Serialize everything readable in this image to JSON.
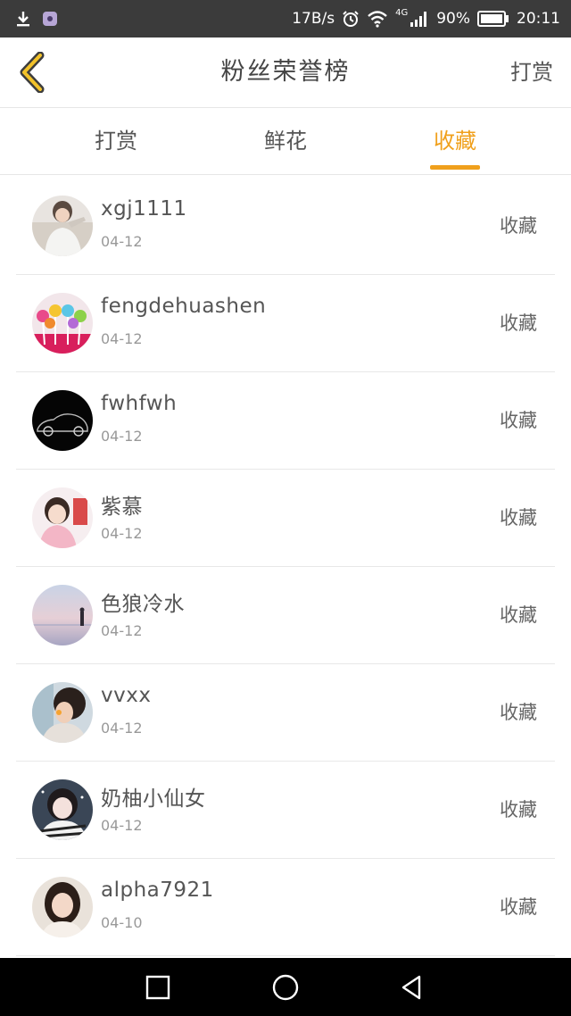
{
  "status_bar": {
    "speed": "17B/s",
    "network": "4G",
    "battery": "90%",
    "time": "20:11"
  },
  "header": {
    "title": "粉丝荣誉榜",
    "action": "打赏"
  },
  "tabs": [
    {
      "label": "打赏",
      "active": false
    },
    {
      "label": "鲜花",
      "active": false
    },
    {
      "label": "收藏",
      "active": true
    }
  ],
  "accent_color": "#f0a01c",
  "list": [
    {
      "name": "xgj1111",
      "date": "04-12",
      "action": "收藏"
    },
    {
      "name": "fengdehuashen",
      "date": "04-12",
      "action": "收藏"
    },
    {
      "name": "fwhfwh",
      "date": "04-12",
      "action": "收藏"
    },
    {
      "name": "紫慕",
      "date": "04-12",
      "action": "收藏"
    },
    {
      "name": "色狼冷水",
      "date": "04-12",
      "action": "收藏"
    },
    {
      "name": "vvxx",
      "date": "04-12",
      "action": "收藏"
    },
    {
      "name": "奶柚小仙女",
      "date": "04-12",
      "action": "收藏"
    },
    {
      "name": "alpha7921",
      "date": "04-10",
      "action": "收藏"
    }
  ],
  "icons": {
    "back": "chevron-left-icon",
    "recent": "square-icon",
    "home": "circle-icon",
    "nav_back": "triangle-back-icon"
  }
}
